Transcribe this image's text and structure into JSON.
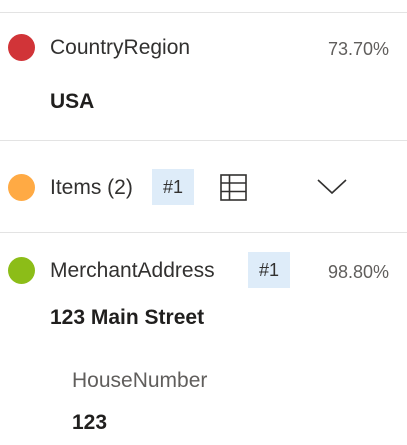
{
  "fields": [
    {
      "name": "CountryRegion",
      "confidence": "73.70%",
      "value": "USA",
      "color": "#d13438"
    },
    {
      "name": "Items (2)",
      "badge": "#1",
      "color": "#ffaa44",
      "icons": [
        "table-icon",
        "chevron-down-icon"
      ]
    },
    {
      "name": "MerchantAddress",
      "badge": "#1",
      "confidence": "98.80%",
      "value": "123 Main Street",
      "color": "#8cbd18",
      "subfields": [
        {
          "name": "HouseNumber",
          "value": "123"
        }
      ]
    }
  ]
}
